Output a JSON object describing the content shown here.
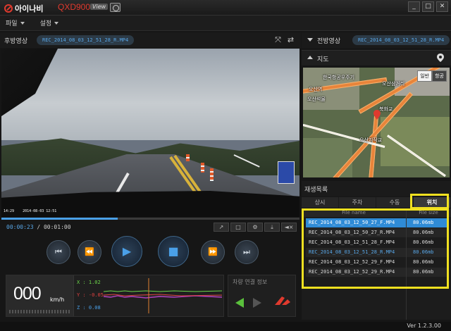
{
  "app": {
    "brand": "아이나비",
    "model": "QXD900",
    "view_badge": "View"
  },
  "window_buttons": [
    "_",
    "□",
    "✕"
  ],
  "menu": [
    {
      "label": "파일"
    },
    {
      "label": "설정"
    }
  ],
  "rear": {
    "label": "후방영상",
    "file": "REC_2014_08_03_12_51_28_R.MP4"
  },
  "front": {
    "label": "전방영상",
    "file": "REC_2014_08_03_12_51_28_R.MP4"
  },
  "video": {
    "osd_left": "14:29",
    "osd_mid": "2014-08-03 12:51",
    "progress_fraction": 0.39
  },
  "playback": {
    "current": "00:00:23",
    "separator": " / ",
    "total": "00:01:00"
  },
  "sensors": {
    "speed": "000",
    "unit": "km/h",
    "x": "X : 1.02",
    "y": "Y : -0.05",
    "z": "Z : 0.08"
  },
  "link": {
    "title": "차량 연결 정보"
  },
  "map": {
    "title": "지도",
    "toggle": [
      {
        "label": "일반"
      },
      {
        "label": "항공"
      }
    ],
    "labels": [
      "한국항공우주기",
      "오산삼거리",
      "오산역",
      "북화교",
      "오산지작교",
      "오산석물"
    ]
  },
  "playlist": {
    "title": "재생목록",
    "tabs": [
      {
        "label": "상시"
      },
      {
        "label": "주차"
      },
      {
        "label": "수동"
      },
      {
        "label": "위치"
      }
    ],
    "columns": [
      "File name",
      "File size"
    ],
    "rows": [
      {
        "name": "REC_2014_08_03_12_50_27_F.MP4",
        "size": "80.06mb"
      },
      {
        "name": "REC_2014_08_03_12_50_27_R.MP4",
        "size": "80.06mb"
      },
      {
        "name": "REC_2014_08_03_12_51_28_F.MP4",
        "size": "80.06mb"
      },
      {
        "name": "REC_2014_08_03_12_51_28_R.MP4",
        "size": "80.06mb"
      },
      {
        "name": "REC_2014_08_03_12_52_29_F.MP4",
        "size": "80.06mb"
      },
      {
        "name": "REC_2014_08_03_12_52_29_R.MP4",
        "size": "80.06mb"
      }
    ]
  },
  "version": "Ver 1.2.3.00"
}
